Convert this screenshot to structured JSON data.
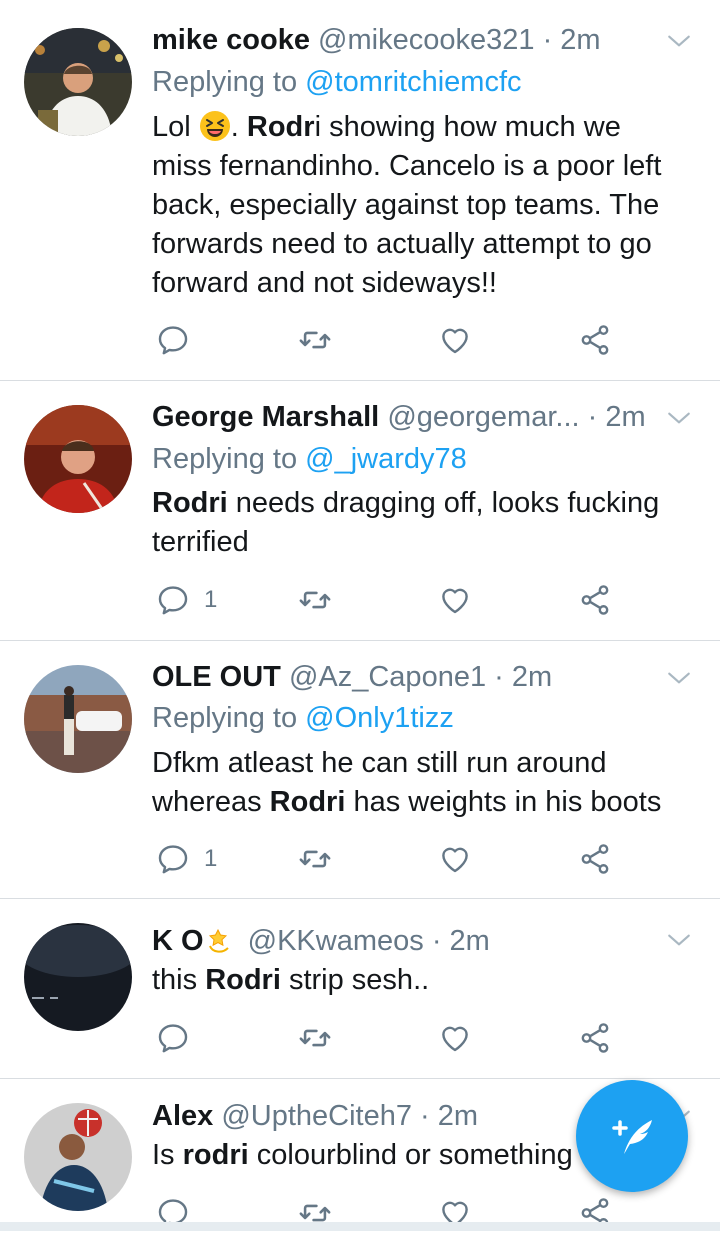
{
  "tweets": [
    {
      "name": "mike cooke",
      "handle": "@mikecooke321",
      "dot": "·",
      "time": "2m",
      "replying_prefix": "Replying to ",
      "replying_to": "@tomritchiemcfc",
      "body_before": "Lol ",
      "body_after_emoji": ". ",
      "body_bold": "Rodr",
      "body_rest": "i showing how much we miss fernandinho. Cancelo is a poor left back, especially against top teams.  The forwards need to actually attempt to go forward and not sideways!!",
      "reply_count": ""
    },
    {
      "name": "George Marshall",
      "handle": "@georgemar...",
      "dot": "·",
      "time": "2m",
      "replying_prefix": "Replying to ",
      "replying_to": "@_jwardy78",
      "body_bold": "Rodri",
      "body_rest": " needs dragging off, looks fucking terrified",
      "reply_count": "1"
    },
    {
      "name": "OLE OUT",
      "handle": "@Az_Capone1",
      "dot": "·",
      "time": "2m",
      "replying_prefix": "Replying to ",
      "replying_to": "@Only1tizz",
      "body_before": "Dfkm atleast he can still run around whereas ",
      "body_bold": "Rodri",
      "body_rest": " has weights in his boots",
      "reply_count": "1"
    },
    {
      "name": "K O",
      "handle": "@KKwameos",
      "dot": "·",
      "time": "2m",
      "body_before": "this ",
      "body_bold": "Rodri",
      "body_rest": " strip sesh..",
      "reply_count": ""
    },
    {
      "name": "Alex",
      "handle": "@UptheCiteh7",
      "dot": "·",
      "time": "2m",
      "body_before": "Is ",
      "body_bold": "rodri",
      "body_rest": " colourblind or something",
      "reply_count": ""
    }
  ],
  "icons": {
    "reply": "reply-icon",
    "retweet": "retweet-icon",
    "like": "like-icon",
    "share": "share-icon",
    "caret": "chevron-down-icon",
    "compose": "compose-tweet-icon"
  },
  "colors": {
    "accent": "#1da1f2",
    "secondary_text": "#657786",
    "icon_gray": "#657786",
    "divider": "#d9dde1"
  }
}
